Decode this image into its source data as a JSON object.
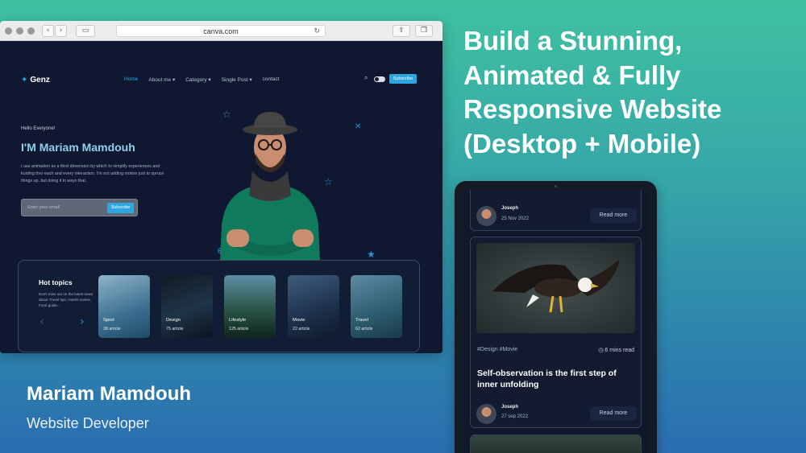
{
  "browser": {
    "url": "canva.com",
    "back_icon": "chevron-left-icon",
    "forward_icon": "chevron-right-icon",
    "reload_icon": "reload-icon"
  },
  "site": {
    "logo": "Genz",
    "nav": [
      "Home",
      "About me ▾",
      "Category ▾",
      "Single Post ▾",
      "contact"
    ],
    "subscribe_top": "Subscribe",
    "hero": {
      "greeting": "Hello Everyone!",
      "name": "I'M Mariam Mamdouh",
      "description": "I use animation as a third dimension by which to simplify experiences and kuiding thro each and every interaction. I'm not adding motion just to spruce things up, but doing it in ways that.",
      "email_placeholder": "Enter your email",
      "subscribe_label": "Subscribe"
    },
    "hot_topics": {
      "title": "Hot topics",
      "description": "Don't miss out on the latest news about Travel tips, Hotels review, Food guide...",
      "cards": [
        {
          "title": "Sport",
          "count": "38 article"
        },
        {
          "title": "Design",
          "count": "75 article"
        },
        {
          "title": "Lifestyle",
          "count": "125 article"
        },
        {
          "title": "Movie",
          "count": "22 article"
        },
        {
          "title": "Travel",
          "count": "62 article"
        }
      ]
    }
  },
  "headline": "Build a Stunning, Animated & Fully Responsive Website (Desktop + Mobile)",
  "author": {
    "name": "Mariam Mamdouh",
    "role": "Website Developer"
  },
  "tablet": {
    "top_card": {
      "name": "Joseph",
      "date": "25 Nov 2022",
      "read_more": "Read more"
    },
    "article": {
      "tags": "#Design #Movie",
      "read_time": "6 mins read",
      "title": "Self-observation is the first step of inner unfolding",
      "author": "Joseph",
      "date": "27 sep 2022",
      "read_more": "Read more"
    }
  },
  "colors": {
    "accent": "#2ea7e0",
    "site_bg": "#0f1830",
    "hero_name": "#8fd0ea"
  }
}
